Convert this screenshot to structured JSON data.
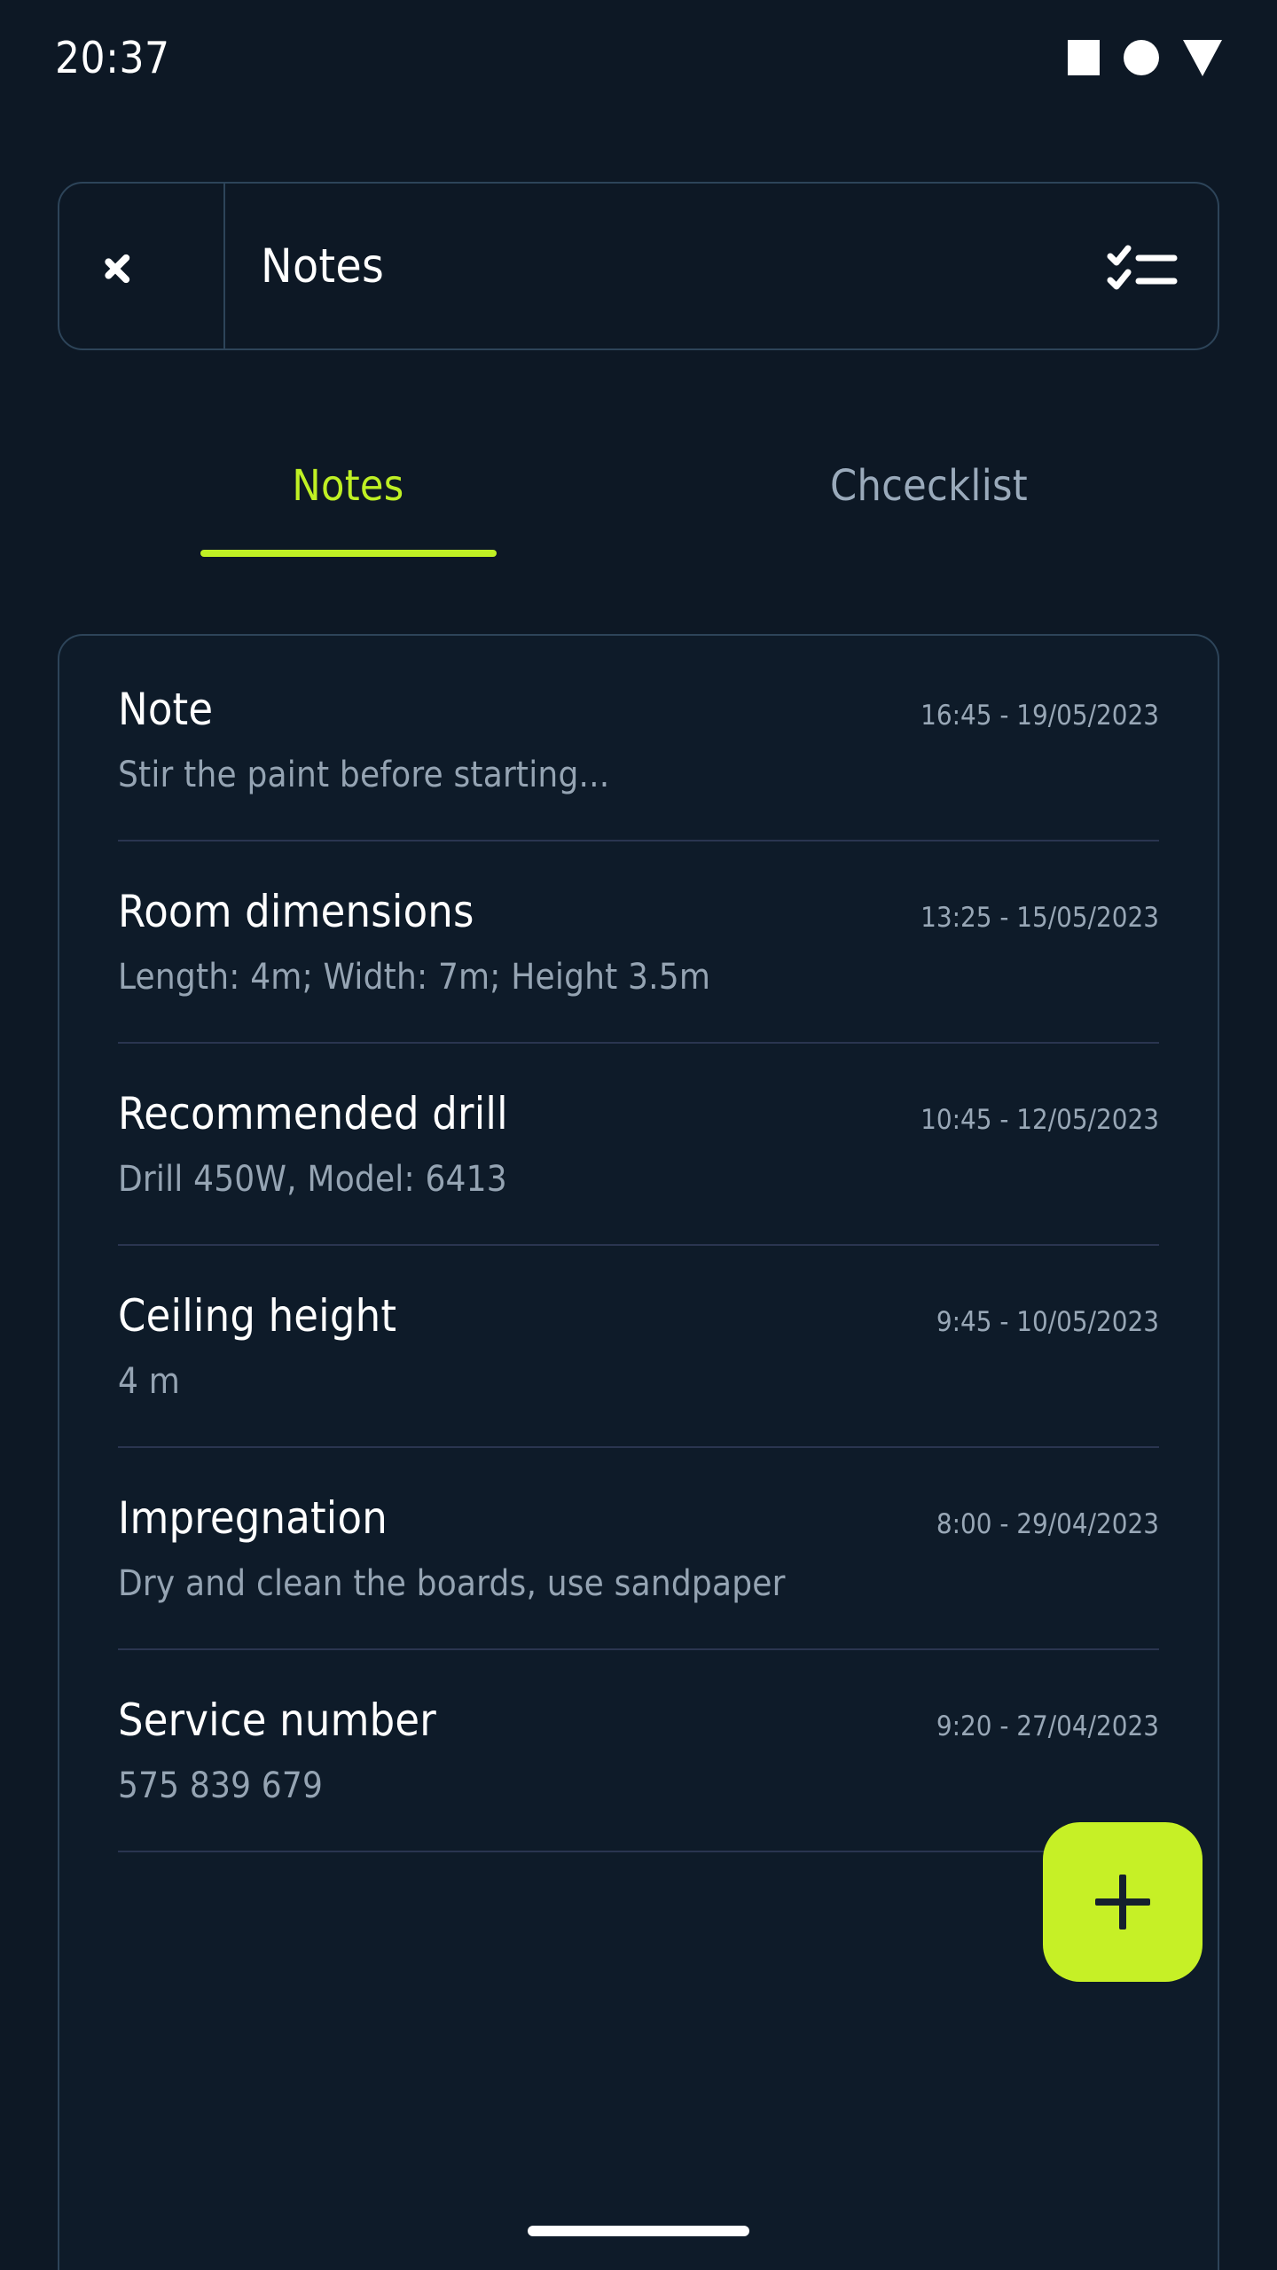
{
  "status_bar": {
    "time": "20:37",
    "icons": [
      "square-icon",
      "circle-icon",
      "triangle-down-icon"
    ]
  },
  "app_bar": {
    "back_icon": "chevron-left-icon",
    "title": "Notes",
    "action_icon": "checklist-icon"
  },
  "tabs": [
    {
      "label": "Notes",
      "active": true
    },
    {
      "label": "Chcecklist",
      "active": false
    }
  ],
  "notes": [
    {
      "title": "Note",
      "timestamp": "16:45 - 19/05/2023",
      "description": "Stir the paint before starting..."
    },
    {
      "title": "Room dimensions",
      "timestamp": "13:25 - 15/05/2023",
      "description": "Length: 4m; Width: 7m; Height 3.5m"
    },
    {
      "title": "Recommended drill",
      "timestamp": "10:45 - 12/05/2023",
      "description": "Drill 450W, Model: 6413"
    },
    {
      "title": "Ceiling height",
      "timestamp": "9:45 - 10/05/2023",
      "description": "4 m"
    },
    {
      "title": "Impregnation",
      "timestamp": "8:00 - 29/04/2023",
      "description": "Dry and clean the boards, use sandpaper"
    },
    {
      "title": "Service number",
      "timestamp": "9:20 - 27/04/2023",
      "description": "575 839 679"
    }
  ],
  "fab": {
    "icon": "plus-icon",
    "label": "+"
  },
  "colors": {
    "background": "#0d1825",
    "card": "#0e1b29",
    "border": "#2d4459",
    "accent": "#bff024",
    "fab": "#c6f026",
    "text_primary": "#ffffff",
    "text_secondary": "#95a4b3"
  }
}
